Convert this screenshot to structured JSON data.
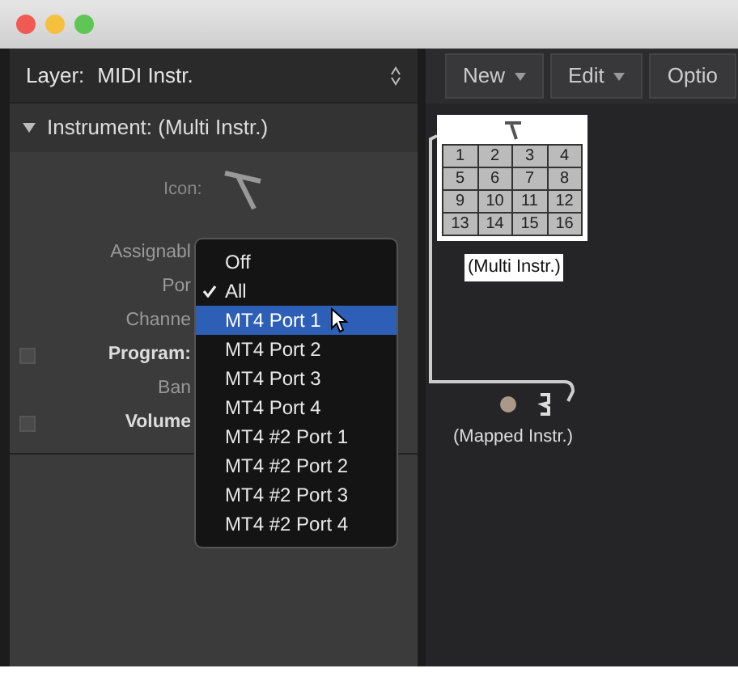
{
  "inspector": {
    "layer_label": "Layer:",
    "layer_value": "MIDI Instr.",
    "section": {
      "title": "Instrument: (Multi Instr.)",
      "expanded": true
    },
    "icon_label": "Icon:",
    "params": [
      {
        "label": "Assignabl",
        "kind": "plain"
      },
      {
        "label": "Por",
        "kind": "plain"
      },
      {
        "label": "Channe",
        "kind": "plain"
      },
      {
        "label": "Program:",
        "kind": "checkbox",
        "checked": false
      },
      {
        "label": "Ban",
        "kind": "plain"
      },
      {
        "label": "Volume",
        "kind": "checkbox",
        "checked": false
      }
    ]
  },
  "port_menu": [
    {
      "label": "Off",
      "checked": false,
      "selected": false
    },
    {
      "label": "All",
      "checked": true,
      "selected": false
    },
    {
      "label": "MT4 Port 1",
      "checked": false,
      "selected": true
    },
    {
      "label": "MT4 Port 2",
      "checked": false,
      "selected": false
    },
    {
      "label": "MT4 Port 3",
      "checked": false,
      "selected": false
    },
    {
      "label": "MT4 Port 4",
      "checked": false,
      "selected": false
    },
    {
      "label": "MT4 #2 Port 1",
      "checked": false,
      "selected": false
    },
    {
      "label": "MT4 #2 Port 2",
      "checked": false,
      "selected": false
    },
    {
      "label": "MT4 #2 Port 3",
      "checked": false,
      "selected": false
    },
    {
      "label": "MT4 #2 Port 4",
      "checked": false,
      "selected": false
    }
  ],
  "toolbar": [
    {
      "label": "New",
      "menu": true
    },
    {
      "label": "Edit",
      "menu": true
    },
    {
      "label": "Optio",
      "menu": false
    }
  ],
  "canvas": {
    "multi_instrument": {
      "name": "(Multi Instr.)",
      "channels": [
        "1",
        "2",
        "3",
        "4",
        "5",
        "6",
        "7",
        "8",
        "9",
        "10",
        "11",
        "12",
        "13",
        "14",
        "15",
        "16"
      ]
    },
    "mapped_instrument": {
      "name": "(Mapped Instr.)"
    }
  }
}
